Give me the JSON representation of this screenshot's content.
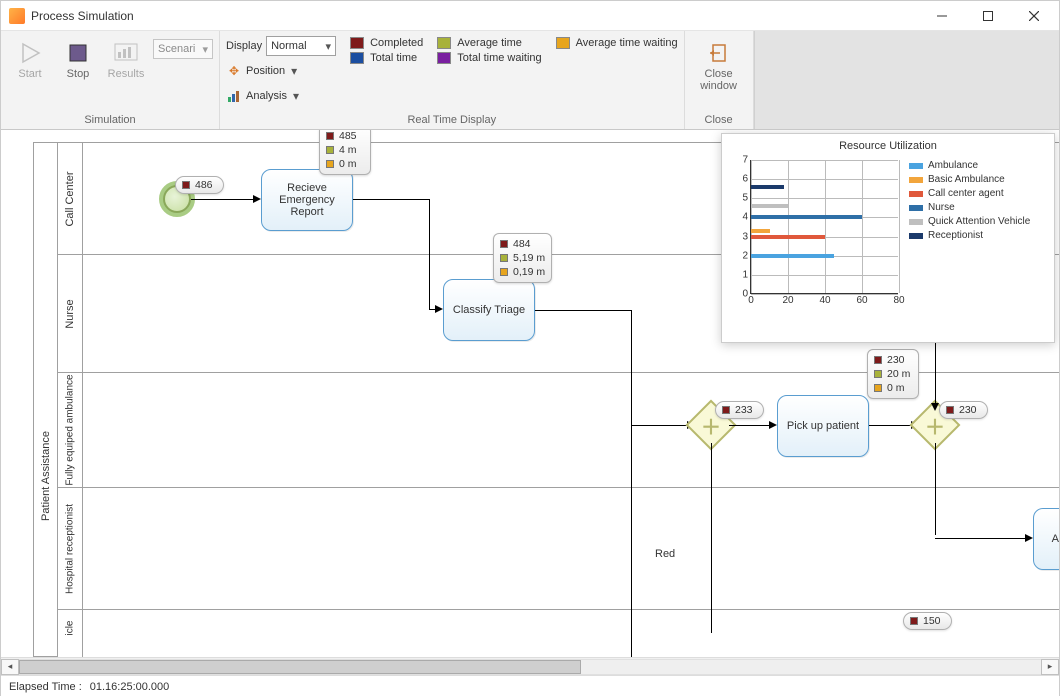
{
  "window": {
    "title": "Process Simulation"
  },
  "ribbon": {
    "simulation": {
      "label": "Simulation",
      "start": "Start",
      "stop": "Stop",
      "results": "Results",
      "scenario_combo": "Scenari"
    },
    "realtime": {
      "label": "Real Time Display",
      "display_label": "Display",
      "display_value": "Normal",
      "position": "Position",
      "analysis": "Analysis",
      "legend": {
        "completed": "Completed",
        "avg_time": "Average time",
        "avg_wait": "Average time waiting",
        "total_time": "Total time",
        "total_wait": "Total time waiting"
      }
    },
    "close": {
      "label_group": "Close",
      "btn_line1": "Close",
      "btn_line2": "window"
    }
  },
  "colors": {
    "completed": "#7e1a1a",
    "avg_time": "#a8b23a",
    "avg_wait": "#e7a51e",
    "total_time": "#1b4ea0",
    "total_wait": "#7a1fa0"
  },
  "pool": "Patient Assistance",
  "lanes": {
    "call_center": "Call Center",
    "nurse": "Nurse",
    "ambulance": "Fully equiped ambulance",
    "reception": "Hospital receptionist",
    "vehicle": "icle"
  },
  "tasks": {
    "recieve": "Recieve Emergency Report",
    "classify": "Classify Triage",
    "pickup": "Pick up patient",
    "auth": "Auth"
  },
  "badges": {
    "start_event": {
      "count": "486"
    },
    "recieve": {
      "completed": "485",
      "avg": "4 m",
      "wait": "0 m"
    },
    "classify": {
      "completed": "484",
      "avg": "5,19 m",
      "wait": "0,19 m"
    },
    "pickup": {
      "completed": "230",
      "avg": "20 m",
      "wait": "0 m"
    },
    "gateway_left": {
      "count": "233"
    },
    "gateway_right": {
      "count": "230"
    },
    "vehicle_partial": {
      "count": "150"
    }
  },
  "flow_labels": {
    "red": "Red"
  },
  "chart_data": {
    "type": "bar",
    "orientation": "horizontal",
    "title": "Resource Utilization",
    "xlim": [
      0,
      80
    ],
    "ylim": [
      0,
      7
    ],
    "xticks": [
      0,
      20,
      40,
      60,
      80
    ],
    "yticks": [
      0,
      1,
      2,
      3,
      4,
      5,
      6,
      7
    ],
    "series": [
      {
        "name": "Ambulance",
        "color": "#4aa3e0",
        "y": 2,
        "value": 45
      },
      {
        "name": "Basic Ambulance",
        "color": "#f2a53c",
        "y": 3.3,
        "value": 10
      },
      {
        "name": "Call center agent",
        "color": "#e0583b",
        "y": 3,
        "value": 40
      },
      {
        "name": "Nurse",
        "color": "#2e6fa7",
        "y": 4,
        "value": 60
      },
      {
        "name": "Quick Attention Vehicle",
        "color": "#bfbfbf",
        "y": 4.6,
        "value": 20
      },
      {
        "name": "Receptionist",
        "color": "#1b3a6b",
        "y": 5.6,
        "value": 18
      }
    ]
  },
  "status": {
    "label": "Elapsed Time :",
    "value": "01.16:25:00.000"
  }
}
